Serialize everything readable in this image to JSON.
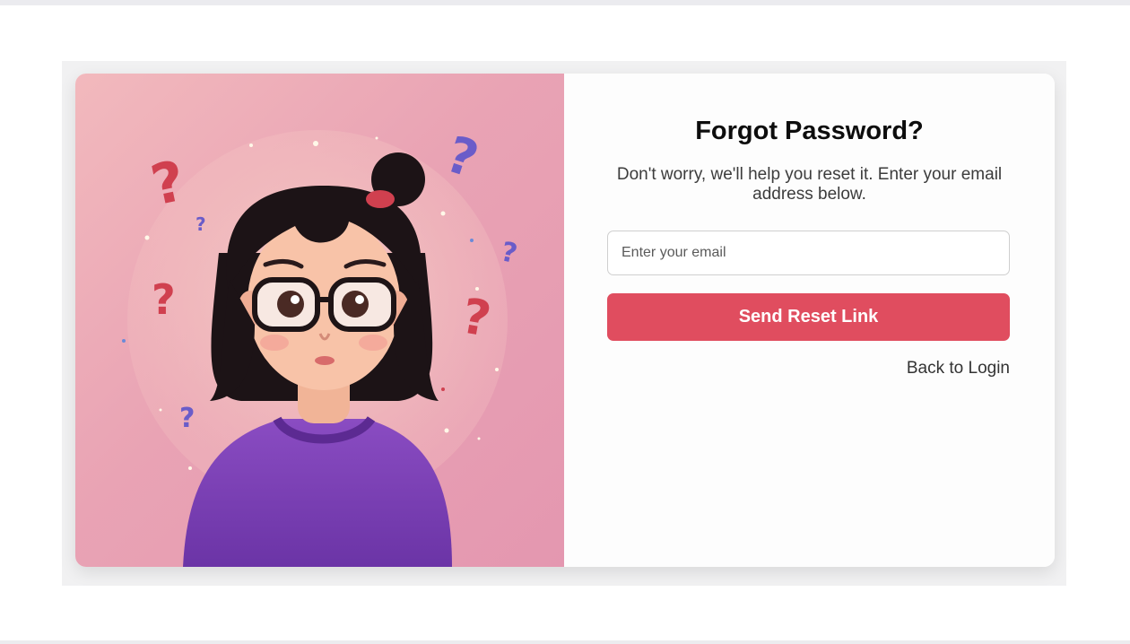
{
  "form": {
    "title": "Forgot Password?",
    "subtitle": "Don't worry, we'll help you reset it. Enter your email address below.",
    "email_placeholder": "Enter your email",
    "email_value": "",
    "submit_label": "Send Reset Link",
    "back_link_label": "Back to Login"
  },
  "illustration": {
    "icon": "confused-girl-illustration",
    "decorations": "question-mark-icons"
  },
  "colors": {
    "accent": "#e04d5f",
    "illustration_bg": "#e9a3b4",
    "sweater": "#7b3fb0",
    "question_red": "#d0404f",
    "question_purple": "#6a5cc9"
  }
}
